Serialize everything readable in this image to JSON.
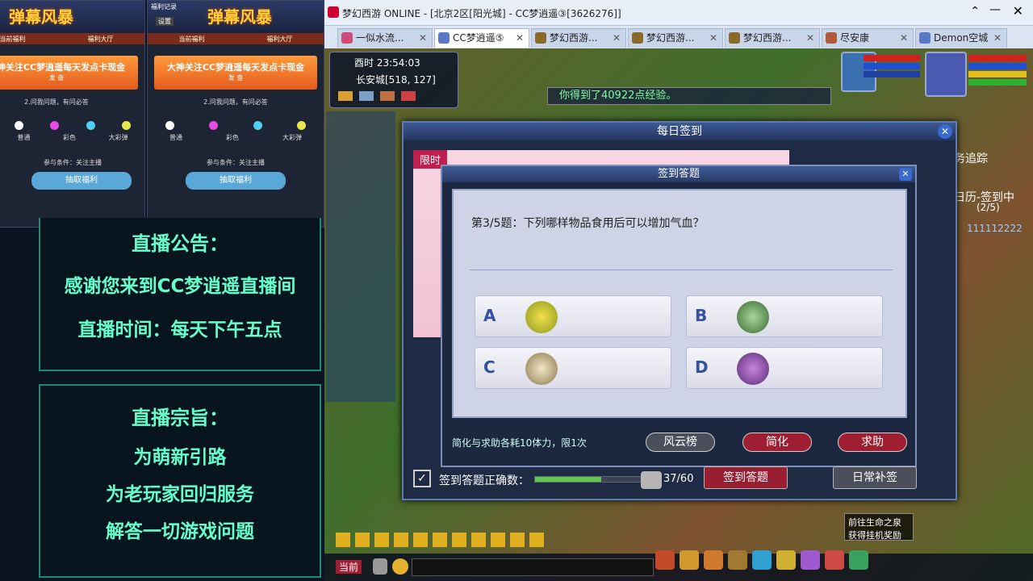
{
  "left_panel": {
    "promo_left": {
      "brand": "弹幕风暴",
      "tabs": [
        "当前福利",
        "福利大厅"
      ],
      "gift_title": "大神关注CC梦逍遥每天发点卡现金",
      "gift_sub": "发 奋",
      "hint": "2.问我问题，有问必答",
      "dot_labels": [
        "普通",
        "彩色",
        "大彩弹"
      ],
      "condition": "参与条件：关注主播",
      "draw_button": "抽取福利"
    },
    "promo_right": {
      "top_labels": [
        "福利记录",
        "设置"
      ],
      "brand": "弹幕风暴",
      "tabs": [
        "当前福利",
        "福利大厅"
      ],
      "gift_title": "大神关注CC梦逍遥每天发点卡现金",
      "gift_sub": "发 奋",
      "hint": "2.问我问题，有问必答",
      "dot_labels": [
        "普通",
        "彩色",
        "大彩弹"
      ],
      "condition": "参与条件：关注主播",
      "draw_button": "抽取福利"
    },
    "notice": {
      "title": "直播公告：",
      "line1": "感谢您来到CC梦逍遥直播间",
      "line2": "直播时间：每天下午五点"
    },
    "purpose": {
      "title": "直播宗旨：",
      "lines": [
        "为萌新引路",
        "为老玩家回归服务",
        "解答一切游戏问题"
      ]
    }
  },
  "window": {
    "title": "梦幻西游 ONLINE - [北京2区[阳光城] - CC梦逍遥③[3626276]]"
  },
  "tabs": [
    "一似水流...",
    "CC梦逍遥⑤",
    "梦幻西游...",
    "梦幻西游...",
    "梦幻西游...",
    "尽安康",
    "Demon空城"
  ],
  "hud": {
    "time": "酉时 23:54:03",
    "location": "长安城[518, 127]",
    "exp_msg": "你得到了40922点经验。",
    "track_label": "务追踪",
    "calendar": "日历-签到中",
    "calendar_count": "(2/5)",
    "player_tag": "111112222"
  },
  "daily_signin": {
    "title": "每日签到",
    "limit_badge": "限时",
    "quiz": {
      "title": "签到答题",
      "question": "第3/5题：下列哪样物品食用后可以增加气血？",
      "options": [
        {
          "letter": "A",
          "item": "corn-item-icon"
        },
        {
          "letter": "B",
          "item": "leaf-herb-item-icon"
        },
        {
          "letter": "C",
          "item": "steamed-buns-item-icon"
        },
        {
          "letter": "D",
          "item": "purple-herb-item-icon"
        }
      ],
      "cost_note": "简化与求助各耗10体力，限1次",
      "buttons": {
        "rank": "风云榜",
        "simplify": "简化",
        "help": "求助"
      }
    },
    "correct_label": "签到答题正确数：",
    "progress_text": "37/60",
    "progress_value": 0.62,
    "signin_quiz_button": "签到答题",
    "daily_makeup_button": "日常补签"
  },
  "bottom": {
    "current_channel": "当前",
    "reward_hint": "前往生命之泉获得挂机奖励"
  },
  "colors": {
    "accent_red": "#b4203a",
    "board_green": "#66ffcc",
    "exp_green": "#7fffa0"
  }
}
